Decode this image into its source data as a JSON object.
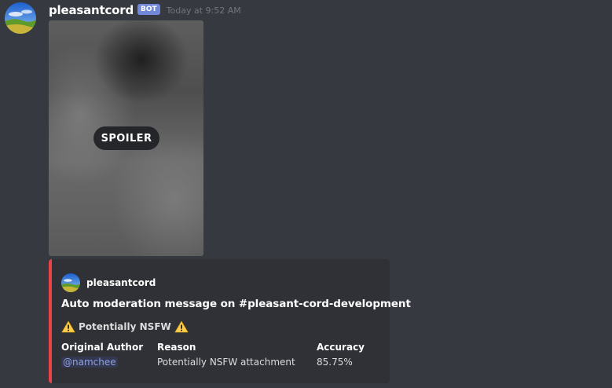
{
  "message": {
    "username": "pleasantcord",
    "bot_tag": "BOT",
    "timestamp": "Today at 9:52 AM",
    "avatar_icon": "landscape-avatar-icon"
  },
  "attachment": {
    "spoiler_label": "SPOILER"
  },
  "embed": {
    "accent_color": "#ed4245",
    "author": {
      "name": "pleasantcord",
      "icon": "landscape-avatar-icon"
    },
    "title": "Auto moderation message on #pleasant-cord-development",
    "description": {
      "text": "Potentially NSFW",
      "icon": "warning-icon"
    },
    "fields": [
      {
        "name": "Original Author",
        "value": "@namchee"
      },
      {
        "name": "Reason",
        "value": "Potentially NSFW attachment"
      },
      {
        "name": "Accuracy",
        "value": "85.75%"
      }
    ]
  }
}
